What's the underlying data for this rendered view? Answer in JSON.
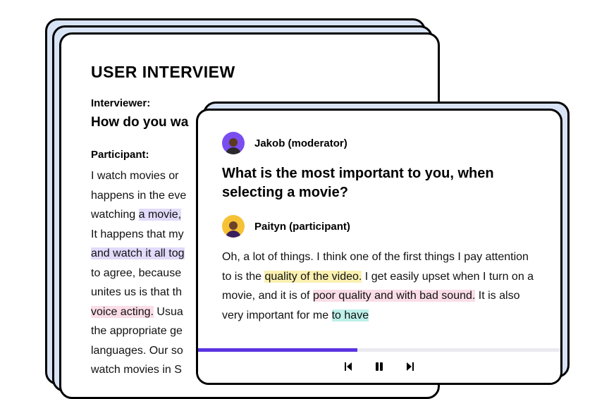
{
  "document": {
    "title": "USER INTERVIEW",
    "interviewer_label": "Interviewer:",
    "question_fragment": "How do you wa",
    "participant_label": "Participant:",
    "body_parts": {
      "p0": "I watch movies or ",
      "p1": "happens in the eve",
      "p2": "watching ",
      "p2_hl": "a movie,",
      "p3": "It happens that my",
      "p4_hl": "and watch it all tog",
      "p5": "to agree, because",
      "p6": "unites us is that th",
      "p7_hl": "voice acting.",
      "p7b": " Usua",
      "p8": "the appropriate ge",
      "p9": "languages. Our so",
      "p10": "watch movies in S"
    }
  },
  "player": {
    "moderator_name": "Jakob (moderator)",
    "question": "What is the most important to you, when selecting a movie?",
    "participant_name": "Paityn (participant)",
    "response": {
      "r0": "Oh, a lot of things. I think one of the first things I pay attention to is the ",
      "r1_hl": "quality of the video.",
      "r2": " I get easily upset when I turn on a movie, and it is of ",
      "r3_hl": "poor quality and with bad sound.",
      "r4": " It is also very important for me ",
      "r5_hl": "to have"
    },
    "progress_percent": 44
  }
}
